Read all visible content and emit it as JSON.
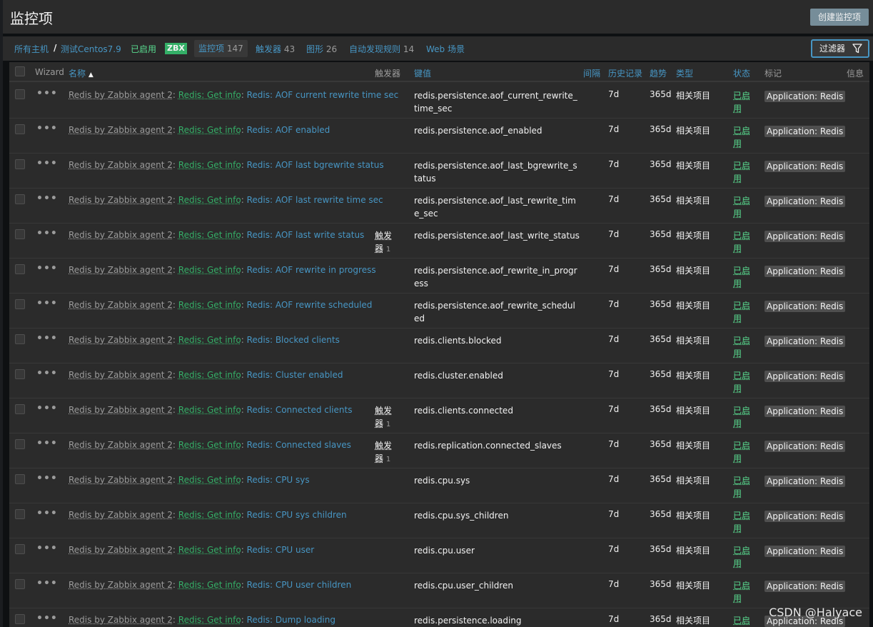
{
  "page": {
    "title": "监控项",
    "create_button": "创建监控项"
  },
  "nav": {
    "all_hosts": "所有主机",
    "separator": "/",
    "host": "测试Centos7.9",
    "enabled": "已启用",
    "zbx": "ZBX",
    "items_label": "监控项",
    "items_count": "147",
    "triggers_label": "触发器",
    "triggers_count": "43",
    "graphs_label": "图形",
    "graphs_count": "26",
    "discovery_label": "自动发现规则",
    "discovery_count": "14",
    "web_label": "Web 场景",
    "filter_button": "过滤器"
  },
  "table": {
    "headers": {
      "wizard": "Wizard",
      "name": "名称",
      "sort_indicator": "▲",
      "triggers": "触发器",
      "key": "键值",
      "interval": "间隔",
      "history": "历史记录",
      "trends": "趋势",
      "type": "类型",
      "status": "状态",
      "tags": "标记",
      "info": "信息"
    },
    "rows": [
      {
        "template": "Redis by Zabbix agent 2",
        "master": "Redis: Get info",
        "name": "Redis: AOF current rewrite time sec",
        "trigger": "",
        "trigger_count": "",
        "key": "redis.persistence.aof_current_rewrite_time_sec",
        "interval": "",
        "history": "7d",
        "trends": "365d",
        "type": "相关项目",
        "status": "已启用",
        "tag": "Application: Redis"
      },
      {
        "template": "Redis by Zabbix agent 2",
        "master": "Redis: Get info",
        "name": "Redis: AOF enabled",
        "trigger": "",
        "trigger_count": "",
        "key": "redis.persistence.aof_enabled",
        "interval": "",
        "history": "7d",
        "trends": "365d",
        "type": "相关项目",
        "status": "已启用",
        "tag": "Application: Redis"
      },
      {
        "template": "Redis by Zabbix agent 2",
        "master": "Redis: Get info",
        "name": "Redis: AOF last bgrewrite status",
        "trigger": "",
        "trigger_count": "",
        "key": "redis.persistence.aof_last_bgrewrite_status",
        "interval": "",
        "history": "7d",
        "trends": "365d",
        "type": "相关项目",
        "status": "已启用",
        "tag": "Application: Redis"
      },
      {
        "template": "Redis by Zabbix agent 2",
        "master": "Redis: Get info",
        "name": "Redis: AOF last rewrite time sec",
        "trigger": "",
        "trigger_count": "",
        "key": "redis.persistence.aof_last_rewrite_time_sec",
        "interval": "",
        "history": "7d",
        "trends": "365d",
        "type": "相关项目",
        "status": "已启用",
        "tag": "Application: Redis"
      },
      {
        "template": "Redis by Zabbix agent 2",
        "master": "Redis: Get info",
        "name": "Redis: AOF last write status",
        "trigger": "触发器",
        "trigger_count": "1",
        "key": "redis.persistence.aof_last_write_status",
        "interval": "",
        "history": "7d",
        "trends": "365d",
        "type": "相关项目",
        "status": "已启用",
        "tag": "Application: Redis"
      },
      {
        "template": "Redis by Zabbix agent 2",
        "master": "Redis: Get info",
        "name": "Redis: AOF rewrite in progress",
        "trigger": "",
        "trigger_count": "",
        "key": "redis.persistence.aof_rewrite_in_progress",
        "interval": "",
        "history": "7d",
        "trends": "365d",
        "type": "相关项目",
        "status": "已启用",
        "tag": "Application: Redis"
      },
      {
        "template": "Redis by Zabbix agent 2",
        "master": "Redis: Get info",
        "name": "Redis: AOF rewrite scheduled",
        "trigger": "",
        "trigger_count": "",
        "key": "redis.persistence.aof_rewrite_scheduled",
        "interval": "",
        "history": "7d",
        "trends": "365d",
        "type": "相关项目",
        "status": "已启用",
        "tag": "Application: Redis"
      },
      {
        "template": "Redis by Zabbix agent 2",
        "master": "Redis: Get info",
        "name": "Redis: Blocked clients",
        "trigger": "",
        "trigger_count": "",
        "key": "redis.clients.blocked",
        "interval": "",
        "history": "7d",
        "trends": "365d",
        "type": "相关项目",
        "status": "已启用",
        "tag": "Application: Redis"
      },
      {
        "template": "Redis by Zabbix agent 2",
        "master": "Redis: Get info",
        "name": "Redis: Cluster enabled",
        "trigger": "",
        "trigger_count": "",
        "key": "redis.cluster.enabled",
        "interval": "",
        "history": "7d",
        "trends": "365d",
        "type": "相关项目",
        "status": "已启用",
        "tag": "Application: Redis"
      },
      {
        "template": "Redis by Zabbix agent 2",
        "master": "Redis: Get info",
        "name": "Redis: Connected clients",
        "trigger": "触发器",
        "trigger_count": "1",
        "key": "redis.clients.connected",
        "interval": "",
        "history": "7d",
        "trends": "365d",
        "type": "相关项目",
        "status": "已启用",
        "tag": "Application: Redis"
      },
      {
        "template": "Redis by Zabbix agent 2",
        "master": "Redis: Get info",
        "name": "Redis: Connected slaves",
        "trigger": "触发器",
        "trigger_count": "1",
        "key": "redis.replication.connected_slaves",
        "interval": "",
        "history": "7d",
        "trends": "365d",
        "type": "相关项目",
        "status": "已启用",
        "tag": "Application: Redis"
      },
      {
        "template": "Redis by Zabbix agent 2",
        "master": "Redis: Get info",
        "name": "Redis: CPU sys",
        "trigger": "",
        "trigger_count": "",
        "key": "redis.cpu.sys",
        "interval": "",
        "history": "7d",
        "trends": "365d",
        "type": "相关项目",
        "status": "已启用",
        "tag": "Application: Redis"
      },
      {
        "template": "Redis by Zabbix agent 2",
        "master": "Redis: Get info",
        "name": "Redis: CPU sys children",
        "trigger": "",
        "trigger_count": "",
        "key": "redis.cpu.sys_children",
        "interval": "",
        "history": "7d",
        "trends": "365d",
        "type": "相关项目",
        "status": "已启用",
        "tag": "Application: Redis"
      },
      {
        "template": "Redis by Zabbix agent 2",
        "master": "Redis: Get info",
        "name": "Redis: CPU user",
        "trigger": "",
        "trigger_count": "",
        "key": "redis.cpu.user",
        "interval": "",
        "history": "7d",
        "trends": "365d",
        "type": "相关项目",
        "status": "已启用",
        "tag": "Application: Redis"
      },
      {
        "template": "Redis by Zabbix agent 2",
        "master": "Redis: Get info",
        "name": "Redis: CPU user children",
        "trigger": "",
        "trigger_count": "",
        "key": "redis.cpu.user_children",
        "interval": "",
        "history": "7d",
        "trends": "365d",
        "type": "相关项目",
        "status": "已启用",
        "tag": "Application: Redis"
      },
      {
        "template": "Redis by Zabbix agent 2",
        "master": "Redis: Get info",
        "name": "Redis: Dump loading",
        "trigger": "",
        "trigger_count": "",
        "key": "redis.persistence.loading",
        "interval": "",
        "history": "7d",
        "trends": "365d",
        "type": "相关项目",
        "status": "已启用",
        "tag": "Application: Redis"
      }
    ]
  },
  "watermark": "CSDN @Halyace",
  "colors": {
    "background": "#0e1012",
    "panel": "#2b2b2b",
    "link": "#4796c4",
    "enabled": "#59db8f",
    "master": "#34af67",
    "muted": "#9b9b9b"
  }
}
